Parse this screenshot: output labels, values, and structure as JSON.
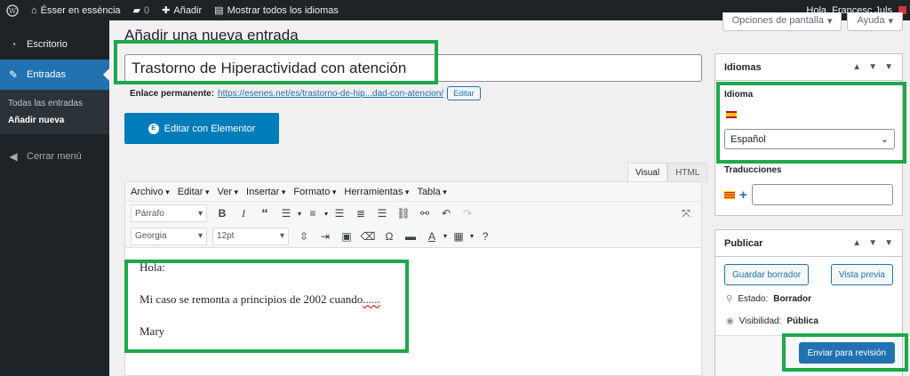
{
  "adminbar": {
    "site_name": "Ésser en essència",
    "comments_count": "0",
    "new_label": "Añadir",
    "languages_label": "Mostrar todos los idiomas",
    "greeting": "Hola, Francesc Juls"
  },
  "sidebar": {
    "items": [
      {
        "label": "Escritorio",
        "icon": "dashboard-icon"
      },
      {
        "label": "Entradas",
        "icon": "pin-icon"
      },
      {
        "label": "Cerrar menú",
        "icon": "collapse-icon"
      }
    ],
    "submenu": [
      "Todas las entradas",
      "Añadir nueva"
    ]
  },
  "screen_meta": {
    "options": "Opciones de pantalla",
    "help": "Ayuda"
  },
  "page": {
    "title": "Añadir una nueva entrada",
    "post_title": "Trastorno de Hiperactividad con atención",
    "permalink_label": "Enlace permanente:",
    "permalink_url": "https://esenes.net/es/trastorno-de-hip...dad-con-atencion/",
    "edit_label": "Editar",
    "elementor_label": "Editar con Elementor"
  },
  "editor": {
    "tabs": [
      "Visual",
      "HTML"
    ],
    "menus": [
      "Archivo",
      "Editar",
      "Ver",
      "Insertar",
      "Formato",
      "Herramientas",
      "Tabla"
    ],
    "format_select": "Párrafo",
    "font_select": "Georgia",
    "size_select": "12pt",
    "content": [
      "Hola:",
      "Mi caso se remonta a principios de 2002 cuando",
      "......",
      "Mary"
    ]
  },
  "languages_box": {
    "title": "Idiomas",
    "language_label": "Idioma",
    "selected_language": "Español",
    "translations_label": "Traducciones"
  },
  "publish_box": {
    "title": "Publicar",
    "save_draft": "Guardar borrador",
    "preview": "Vista previa",
    "status_label": "Estado:",
    "status_value": "Borrador",
    "visibility_label": "Visibilidad:",
    "visibility_value": "Pública",
    "submit": "Enviar para revisión"
  },
  "colors": {
    "highlight": "#1ea84a",
    "accent": "#2271b1",
    "admin_dark": "#1d2327"
  }
}
